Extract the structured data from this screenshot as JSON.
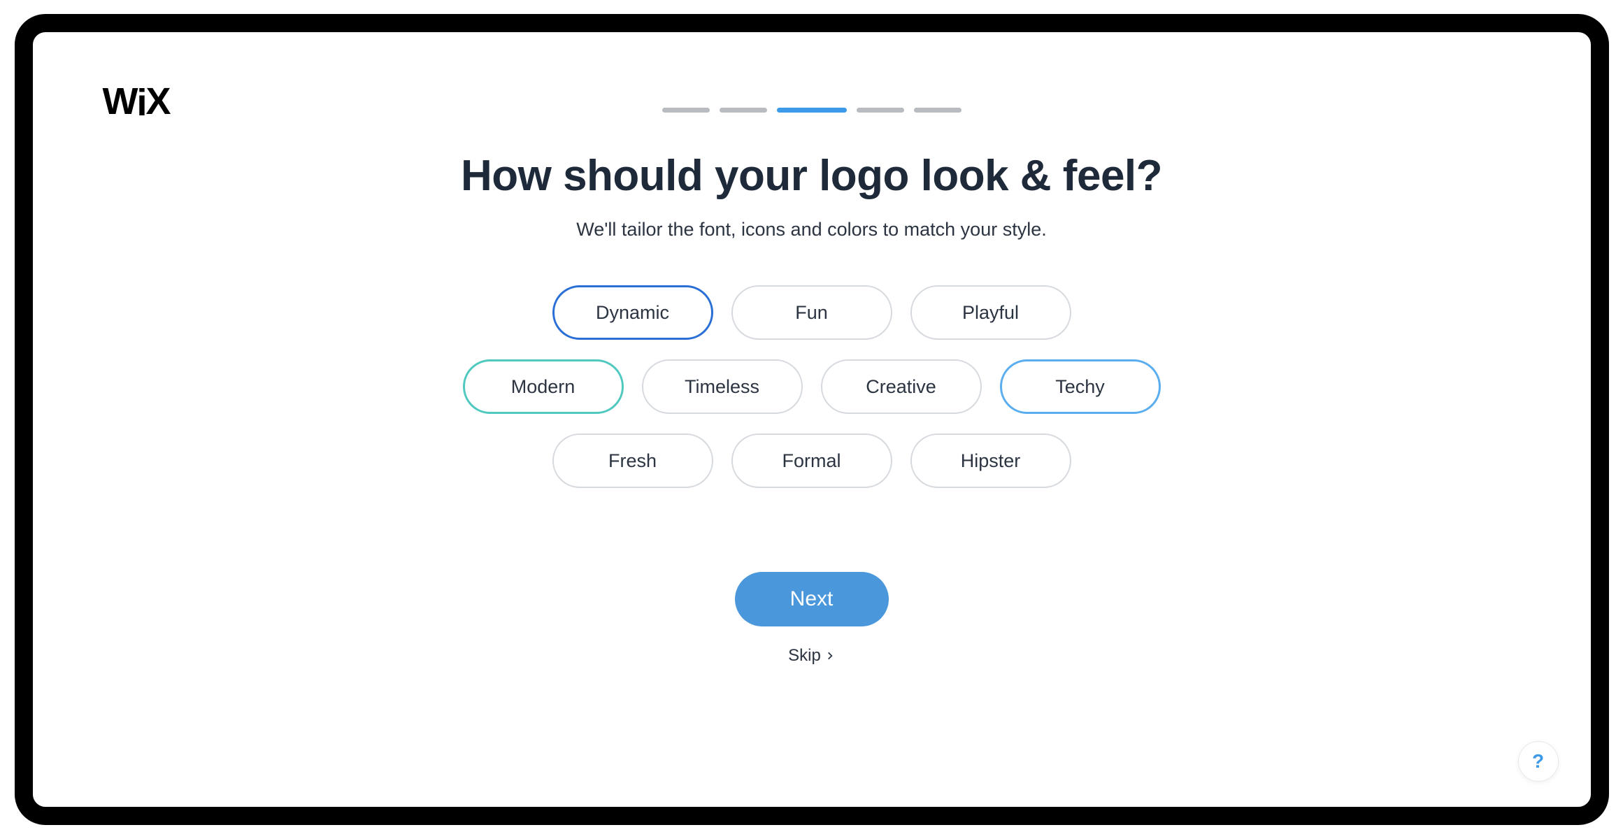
{
  "brand": "WiX",
  "progress": {
    "total": 5,
    "active_index": 2
  },
  "headline": "How should your logo look & feel?",
  "subtitle": "We'll tailor the font, icons and colors to match your style.",
  "chips": {
    "rows": [
      [
        {
          "label": "Dynamic",
          "selected": true,
          "variant": "blue"
        },
        {
          "label": "Fun",
          "selected": false,
          "variant": ""
        },
        {
          "label": "Playful",
          "selected": false,
          "variant": ""
        }
      ],
      [
        {
          "label": "Modern",
          "selected": true,
          "variant": "teal"
        },
        {
          "label": "Timeless",
          "selected": false,
          "variant": ""
        },
        {
          "label": "Creative",
          "selected": false,
          "variant": ""
        },
        {
          "label": "Techy",
          "selected": true,
          "variant": "light"
        }
      ],
      [
        {
          "label": "Fresh",
          "selected": false,
          "variant": ""
        },
        {
          "label": "Formal",
          "selected": false,
          "variant": ""
        },
        {
          "label": "Hipster",
          "selected": false,
          "variant": ""
        }
      ]
    ]
  },
  "actions": {
    "next": "Next",
    "skip": "Skip"
  },
  "help_label": "?"
}
